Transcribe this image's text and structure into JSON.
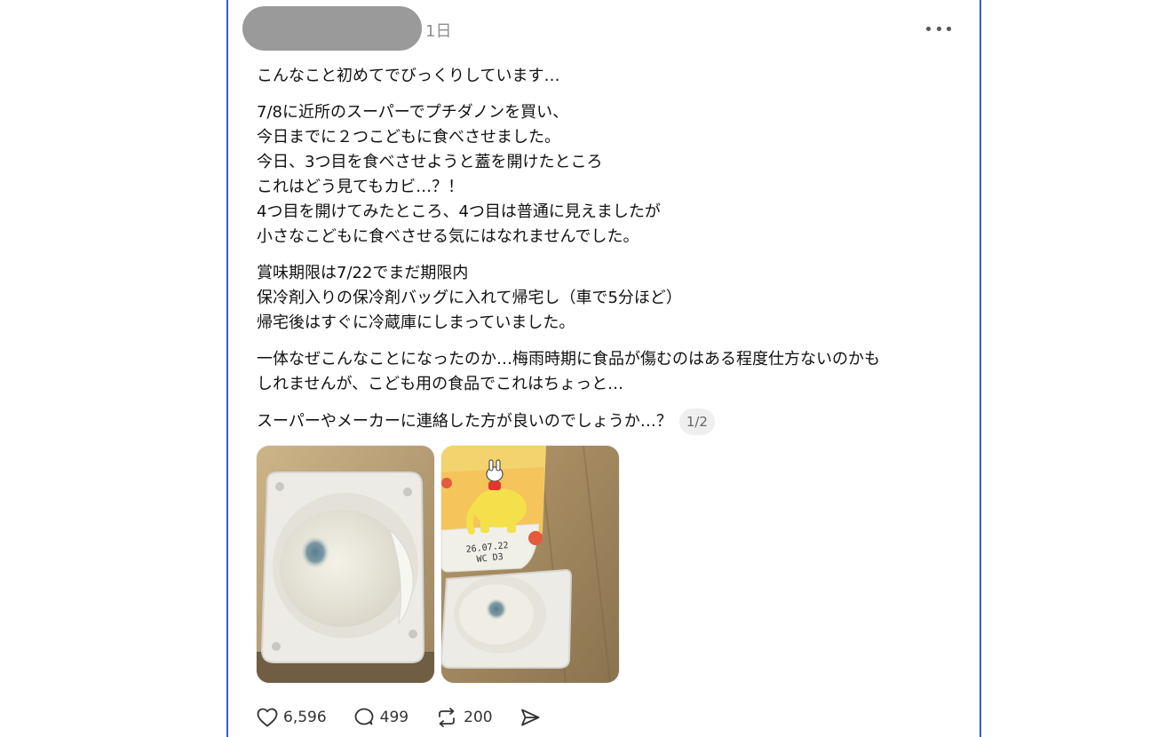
{
  "post": {
    "timestamp": "1日",
    "paragraphs": [
      [
        "こんなこと初めてでびっくりしています…"
      ],
      [
        "7/8に近所のスーパーでプチダノンを買い、",
        "今日までに２つこどもに食べさせました。",
        "今日、3つ目を食べさせようと蓋を開けたところ",
        "これはどう見てもカビ…？！",
        "4つ目を開けてみたところ、4つ目は普通に見えましたが",
        "小さなこどもに食べさせる気にはなれませんでした。"
      ],
      [
        "賞味期限は7/22でまだ期限内",
        "保冷剤入りの保冷剤バッグに入れて帰宅し（車で5分ほど）",
        "帰宅後はすぐに冷蔵庫にしまっていました。"
      ],
      [
        "一体なぜこんなことになったのか…梅雨時期に食品が傷むのはある程度仕方ないのかも",
        "しれませんが、こども用の食品でこれはちょっと…"
      ]
    ],
    "last_line": "スーパーやメーカーに連絡した方が良いのでしょうか…？",
    "page_indicator": "1/2",
    "images": [
      {
        "alt": "yogurt cup with blue mold spot"
      },
      {
        "alt": "yogurt lid with date 26.07.22 WC D3 and moldy cup",
        "lid_text_1": "26.07.22",
        "lid_text_2": "WC D3"
      }
    ],
    "actions": {
      "likes": "6,596",
      "replies": "499",
      "reposts": "200"
    }
  },
  "icons": {
    "like": "heart-icon",
    "reply": "speech-bubble-icon",
    "repost": "repost-arrows-icon",
    "share": "paper-plane-icon",
    "more": "more-dots-icon"
  },
  "colors": {
    "accent_border": "#3a5bd0",
    "redaction": "#9a9a9a",
    "muted_text": "#8e8e8e"
  }
}
